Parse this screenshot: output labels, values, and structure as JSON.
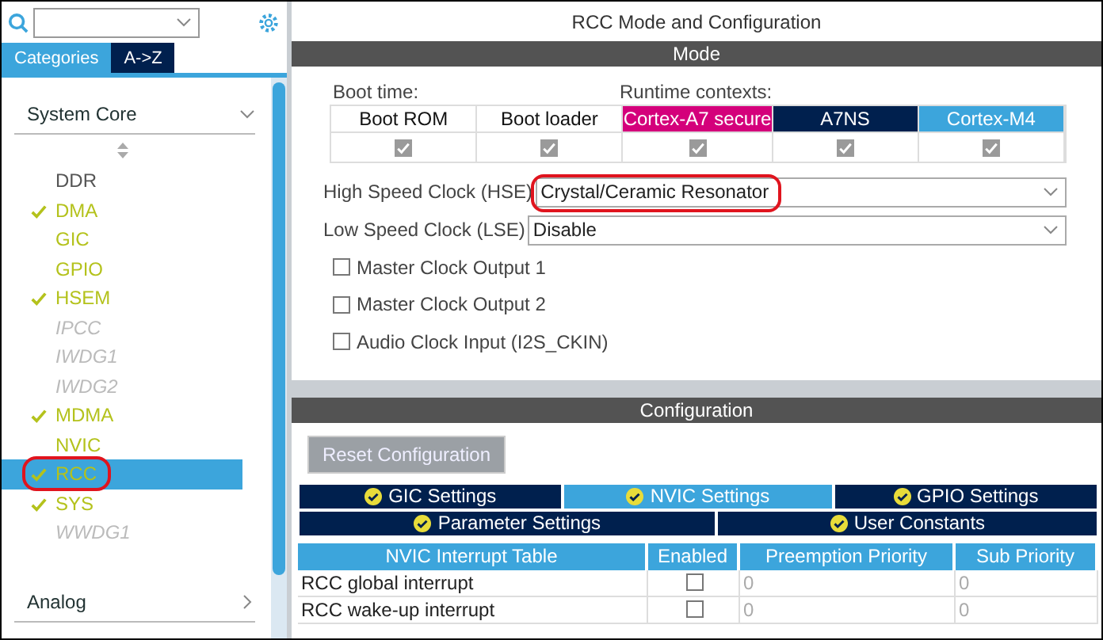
{
  "sidebar": {
    "tabs": [
      {
        "label": "Categories",
        "selected": true
      },
      {
        "label": "A->Z",
        "selected": false
      }
    ],
    "category": {
      "label": "System Core",
      "expanded": true
    },
    "items": [
      {
        "label": "DDR",
        "kind": "plain",
        "checked": false,
        "selected": false,
        "highlighted": false
      },
      {
        "label": "DMA",
        "kind": "ready",
        "checked": true,
        "selected": false,
        "highlighted": false
      },
      {
        "label": "GIC",
        "kind": "ready",
        "checked": false,
        "selected": false,
        "highlighted": false
      },
      {
        "label": "GPIO",
        "kind": "ready",
        "checked": false,
        "selected": false,
        "highlighted": false
      },
      {
        "label": "HSEM",
        "kind": "ready",
        "checked": true,
        "selected": false,
        "highlighted": false
      },
      {
        "label": "IPCC",
        "kind": "unavailable",
        "checked": false,
        "selected": false,
        "highlighted": false
      },
      {
        "label": "IWDG1",
        "kind": "unavailable",
        "checked": false,
        "selected": false,
        "highlighted": false
      },
      {
        "label": "IWDG2",
        "kind": "unavailable",
        "checked": false,
        "selected": false,
        "highlighted": false
      },
      {
        "label": "MDMA",
        "kind": "ready",
        "checked": true,
        "selected": false,
        "highlighted": false
      },
      {
        "label": "NVIC",
        "kind": "ready",
        "checked": false,
        "selected": false,
        "highlighted": false
      },
      {
        "label": "RCC",
        "kind": "ready",
        "checked": true,
        "selected": true,
        "highlighted": true
      },
      {
        "label": "SYS",
        "kind": "ready",
        "checked": true,
        "selected": false,
        "highlighted": false
      },
      {
        "label": "WWDG1",
        "kind": "unavailable",
        "checked": false,
        "selected": false,
        "highlighted": false
      }
    ],
    "next_category": {
      "label": "Analog",
      "expanded": false
    }
  },
  "panel": {
    "title": "RCC Mode and Configuration",
    "mode": {
      "header": "Mode",
      "boot_label": "Boot time:",
      "runtime_label": "Runtime contexts:",
      "contexts": [
        {
          "label": "Boot ROM",
          "color": "#ffffff",
          "checked": true
        },
        {
          "label": "Boot loader",
          "color": "#ffffff",
          "checked": true
        },
        {
          "label": "Cortex-A7 secure",
          "color": "#d4007b",
          "checked": true
        },
        {
          "label": "A7NS",
          "color": "#00204e",
          "checked": true
        },
        {
          "label": "Cortex-M4",
          "color": "#3ca5dc",
          "checked": true
        }
      ],
      "selects": [
        {
          "label": "High Speed Clock (HSE)",
          "value": "Crystal/Ceramic Resonator",
          "highlighted": true
        },
        {
          "label": "Low Speed Clock (LSE)",
          "value": "Disable",
          "highlighted": false
        }
      ],
      "options": [
        {
          "label": "Master Clock Output 1",
          "checked": false
        },
        {
          "label": "Master Clock Output 2",
          "checked": false
        },
        {
          "label": "Audio Clock Input (I2S_CKIN)",
          "checked": false
        }
      ]
    },
    "configuration": {
      "header": "Configuration",
      "reset_button": "Reset Configuration",
      "tab_rows": [
        [
          {
            "label": "GIC Settings",
            "selected": false
          },
          {
            "label": "NVIC Settings",
            "selected": true
          },
          {
            "label": "GPIO Settings",
            "selected": false
          }
        ],
        [
          {
            "label": "Parameter Settings",
            "selected": false
          },
          {
            "label": "User Constants",
            "selected": false
          }
        ]
      ],
      "table": {
        "columns": [
          "NVIC Interrupt Table",
          "Enabled",
          "Preemption Priority",
          "Sub Priority"
        ],
        "rows": [
          {
            "name": "RCC global interrupt",
            "enabled": false,
            "preemption": "0",
            "sub": "0"
          },
          {
            "name": "RCC wake-up interrupt",
            "enabled": false,
            "preemption": "0",
            "sub": "0"
          }
        ]
      }
    }
  }
}
